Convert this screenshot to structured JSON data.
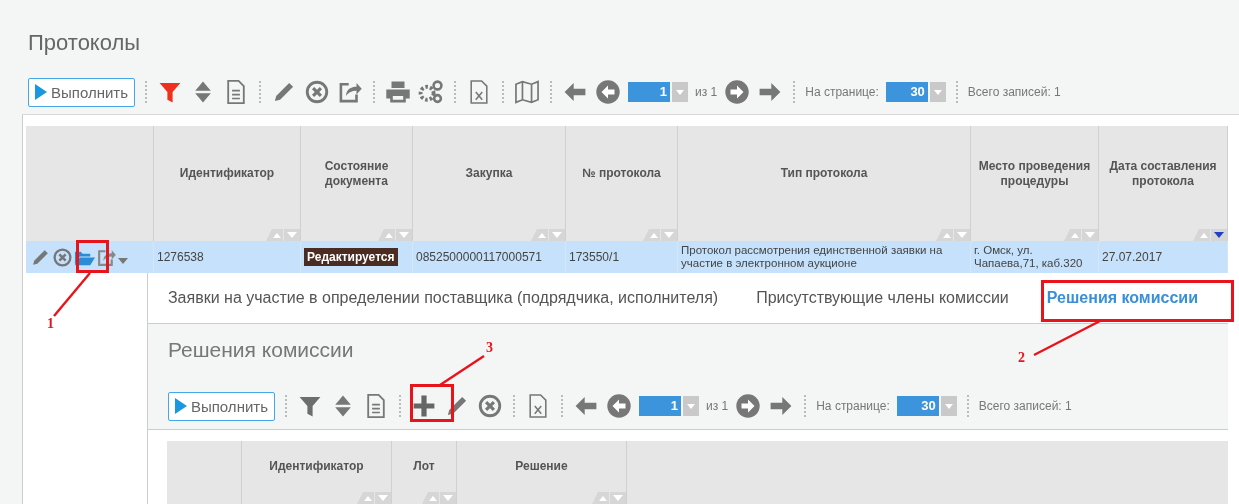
{
  "page": {
    "title": "Протоколы"
  },
  "toolbar": {
    "run_button": "Выполнить",
    "filter_active": true,
    "page": "1",
    "page_of": "из 1",
    "per_page_label": "На странице:",
    "per_page": "30",
    "total": "Всего записей: 1"
  },
  "table": {
    "columns": [
      {
        "label": "Идентификатор",
        "sorted": false
      },
      {
        "label": "Состояние документа",
        "sorted": false
      },
      {
        "label": "Закупка",
        "sorted": false
      },
      {
        "label": "№ протокола",
        "sorted": false
      },
      {
        "label": "Тип протокола",
        "sorted": false
      },
      {
        "label": "Место проведения процедуры",
        "sorted": false
      },
      {
        "label": "Дата составления протокола",
        "sorted": true
      }
    ],
    "rows": [
      {
        "selected": true,
        "cells": [
          {
            "kind": "text",
            "text": "1276538"
          },
          {
            "kind": "badge",
            "text": "Редактируется"
          },
          {
            "kind": "text",
            "text": "0852500000117000571"
          },
          {
            "kind": "text",
            "text": "173550/1"
          },
          {
            "kind": "wrap",
            "text": "Протокол рассмотрения единственной заявки на участие в электронном аукционе"
          },
          {
            "kind": "wrap",
            "text": "г. Омск, ул. Чапаева,71, каб.320"
          },
          {
            "kind": "text",
            "text": "27.07.2017"
          }
        ]
      }
    ]
  },
  "detail": {
    "tabs": [
      {
        "label": "Заявки на участие в определении поставщика (подрядчика, исполнителя)",
        "selected": false
      },
      {
        "label": "Присутствующие члены комиссии",
        "selected": false
      },
      {
        "label": "Решения комиссии",
        "selected": true
      }
    ],
    "title": "Решения комиссии",
    "toolbar": {
      "run_button": "Выполнить",
      "filter_active": false,
      "page": "1",
      "page_of": "из 1",
      "per_page_label": "На странице:",
      "per_page": "30",
      "total": "Всего записей: 1"
    },
    "table": {
      "columns": [
        {
          "label": "Идентификатор",
          "sorted": false
        },
        {
          "label": "Лот",
          "sorted": false
        },
        {
          "label": "Решение",
          "sorted": false
        }
      ]
    }
  },
  "annotations": [
    {
      "label": "1"
    },
    {
      "label": "2"
    },
    {
      "label": "3"
    }
  ]
}
